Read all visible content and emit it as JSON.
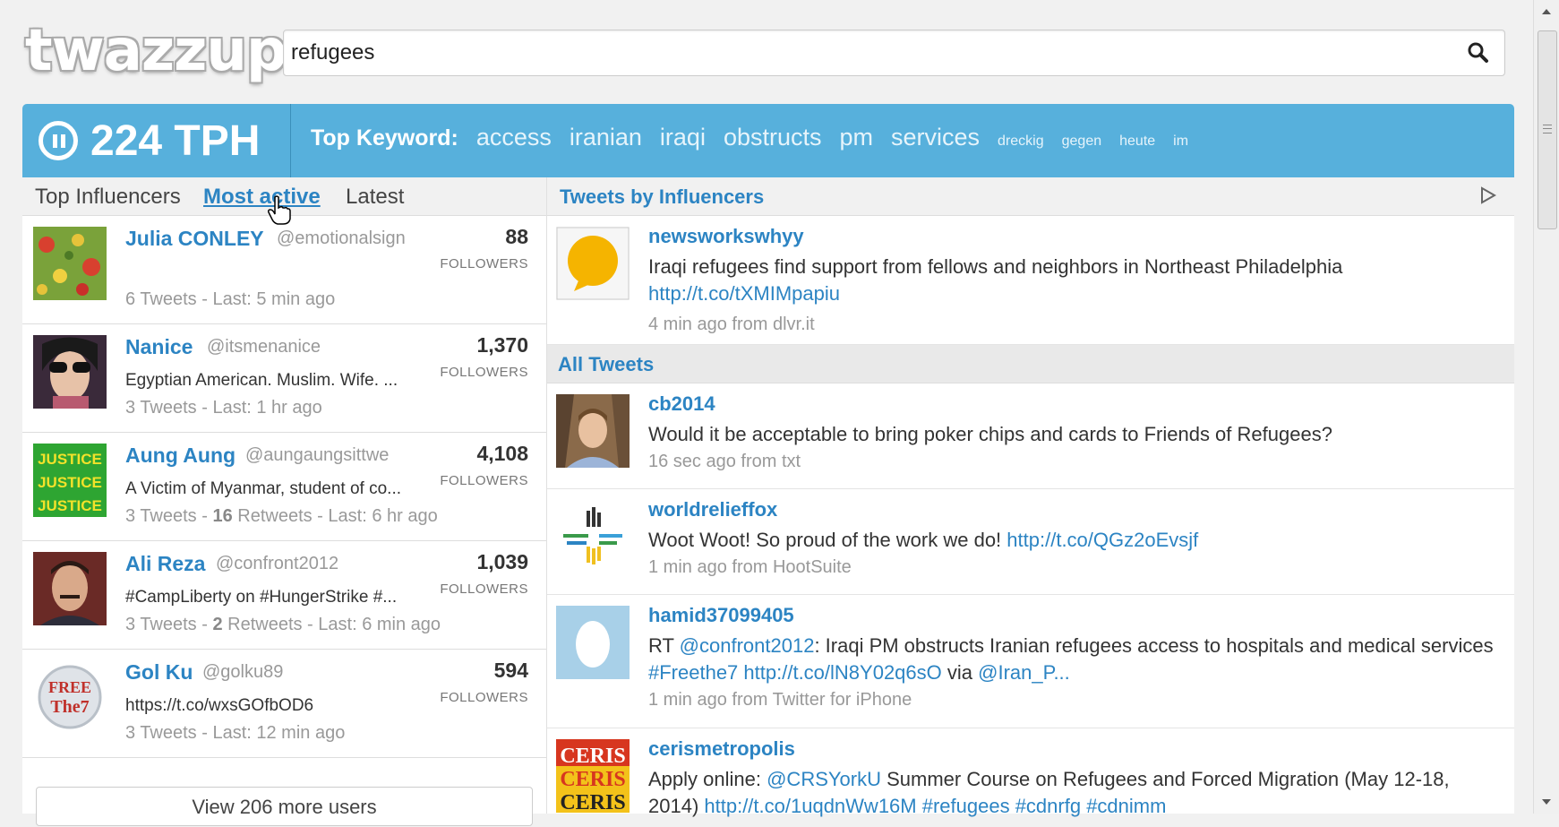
{
  "app": {
    "logo": "twazzup"
  },
  "search": {
    "query": "refugees"
  },
  "stats": {
    "tph": "224 TPH"
  },
  "keywords": {
    "label": "Top Keyword:",
    "major": [
      "access",
      "iranian",
      "iraqi",
      "obstructs",
      "pm",
      "services"
    ],
    "minor": [
      "dreckig",
      "gegen",
      "heute",
      "im"
    ]
  },
  "tabs": {
    "top_influencers": "Top Influencers",
    "most_active": "Most active",
    "latest": "Latest"
  },
  "users": [
    {
      "name": "Julia CONLEY",
      "handle": "@emotionalsign",
      "bio": "",
      "stats": "6 Tweets - Last: 5 min ago",
      "followers": "88",
      "followers_label": "FOLLOWERS"
    },
    {
      "name": "Nanice",
      "handle": "@itsmenanice",
      "bio": "Egyptian American. Muslim. Wife. ...",
      "stats": "3 Tweets - Last: 1 hr ago",
      "followers": "1,370",
      "followers_label": "FOLLOWERS"
    },
    {
      "name": "Aung Aung",
      "handle": "@aungaungsittwe",
      "bio": "A Victim of Myanmar, student of co...",
      "stats_prefix": "3 Tweets - ",
      "retweets": "16",
      "stats_suffix": " Retweets - Last: 6 hr ago",
      "followers": "4,108",
      "followers_label": "FOLLOWERS",
      "avatar_text": "JUSTICE"
    },
    {
      "name": "Ali Reza",
      "handle": "@confront2012",
      "bio": "#CampLiberty on #HungerStrike #...",
      "stats_prefix": "3 Tweets - ",
      "retweets": "2",
      "stats_suffix": " Retweets - Last: 6 min ago",
      "followers": "1,039",
      "followers_label": "FOLLOWERS"
    },
    {
      "name": "Gol Ku",
      "handle": "@golku89",
      "bio": "https://t.co/wxsGOfbOD6",
      "stats": "3 Tweets - Last: 12 min ago",
      "followers": "594",
      "followers_label": "FOLLOWERS",
      "avatar_text_1": "FREE",
      "avatar_text_2": "The7"
    }
  ],
  "more_users": "View 206 more users",
  "influencers": {
    "title": "Tweets by Influencers",
    "tweet": {
      "user": "newsworkswhyy",
      "text": "Iraqi refugees find support from fellows and neighbors in Northeast Philadelphia",
      "link": "http://t.co/tXMIMpapiu",
      "meta": "4 min ago from dlvr.it"
    }
  },
  "all_tweets": {
    "title": "All Tweets",
    "tweets": [
      {
        "user": "cb2014",
        "text": "Would it be acceptable to bring poker chips and cards to Friends of Refugees?",
        "meta": "16 sec ago from txt"
      },
      {
        "user": "worldrelieffox",
        "text": "Woot Woot! So proud of the work we do! ",
        "link": "http://t.co/QGz2oEvsjf",
        "meta": "1 min ago from HootSuite"
      },
      {
        "user": "hamid37099405",
        "rt": "RT ",
        "mention": "@confront2012",
        "text": ": Iraqi PM obstructs Iranian refugees access to hospitals and medical services ",
        "hashtag": "#Freethe7",
        "link": "http://t.co/lN8Y02q6sO",
        "via": " via ",
        "mention2": "@Iran_P...",
        "meta": "1 min ago from Twitter for iPhone"
      },
      {
        "user": "cerismetropolis",
        "text_prefix": "Apply online: ",
        "mention": "@CRSYorkU",
        "text": " Summer Course on Refugees and Forced Migration (May 12-18, 2014) ",
        "link": "http://t.co/1uqdnWw16M",
        "hashtags": " #refugees #cdnrfg #cdnimm",
        "avatar_text": "CERIS"
      }
    ]
  },
  "colors": {
    "accent": "#57b0dc",
    "link": "#2c84c3"
  }
}
